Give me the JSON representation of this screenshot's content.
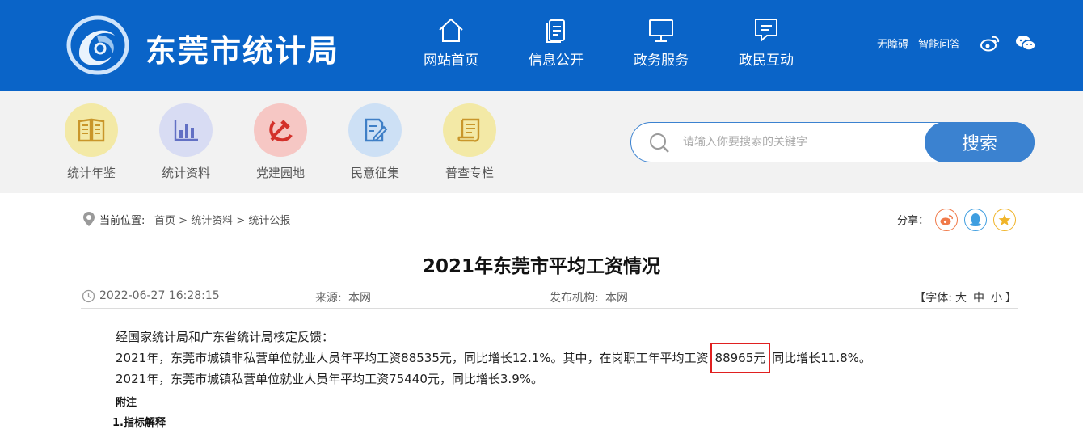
{
  "header": {
    "site_title": "东莞市统计局",
    "nav": [
      {
        "label": "网站首页",
        "icon": "home-icon"
      },
      {
        "label": "信息公开",
        "icon": "document-icon"
      },
      {
        "label": "政务服务",
        "icon": "monitor-icon"
      },
      {
        "label": "政民互动",
        "icon": "message-icon"
      }
    ],
    "links": {
      "accessibility": "无障碍",
      "ai_qa": "智能问答"
    },
    "social": [
      "weibo-icon",
      "wechat-icon"
    ]
  },
  "quick": [
    {
      "label": "统计年鉴",
      "icon": "book-icon",
      "color": "#f3e9a6"
    },
    {
      "label": "统计资料",
      "icon": "bar-chart-icon",
      "color": "#d8dcf3"
    },
    {
      "label": "党建园地",
      "icon": "hammer-sickle-icon",
      "color": "#f6c7c4"
    },
    {
      "label": "民意征集",
      "icon": "edit-icon",
      "color": "#cde0f5"
    },
    {
      "label": "普查专栏",
      "icon": "scroll-icon",
      "color": "#f3e9a6"
    }
  ],
  "search": {
    "placeholder": "请输入你要搜索的关键字",
    "button": "搜索"
  },
  "breadcrumb": {
    "label": "当前位置:",
    "items": [
      "首页",
      "统计资料",
      "统计公报"
    ],
    "sep": " > "
  },
  "share": {
    "label": "分享：",
    "targets": [
      "weibo-share-icon",
      "qq-share-icon",
      "qzone-share-icon"
    ]
  },
  "article": {
    "title": "2021年东莞市平均工资情况",
    "date": "2022-06-27 16:28:15",
    "source_label": "来源:",
    "source": "本网",
    "org_label": "发布机构:",
    "org": "本网",
    "font_label_open": "【字体:",
    "font_options": [
      "大",
      "中",
      "小"
    ],
    "font_label_close": "】",
    "lines": {
      "p1": "经国家统计局和广东省统计局核定反馈：",
      "p2_a": "2021年，东莞市城镇非私营单位就业人员年平均工资88535元，同比增长12.1%。其中，在岗职工年平均工资",
      "p2_highlight": "88965元",
      "p2_b": "同比增长11.8%。",
      "p3": "2021年，东莞市城镇私营单位就业人员年平均工资75440元，同比增长3.9%。",
      "appendix": "附注",
      "section1": "1.指标解释"
    }
  },
  "colors": {
    "header_bg": "#0a64c8",
    "accent": "#3b82d0",
    "highlight_border": "#e02020"
  }
}
